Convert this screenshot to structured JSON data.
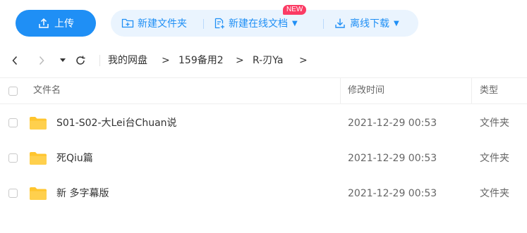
{
  "toolbar": {
    "upload_label": "上传",
    "new_folder_label": "新建文件夹",
    "new_online_doc_label": "新建在线文档",
    "new_badge": "NEW",
    "offline_download_label": "离线下载"
  },
  "navigation": {
    "back_icon": "chevron-left-icon",
    "forward_icon": "chevron-right-icon",
    "history_icon": "caret-down-icon",
    "refresh_icon": "refresh-icon",
    "breadcrumb": [
      "我的网盘",
      "159备用2",
      "R-刃Ya"
    ],
    "separator": ">"
  },
  "table": {
    "columns": [
      "文件名",
      "修改时间",
      "类型"
    ],
    "rows": [
      {
        "name": "S01-S02-大Lei台Chuan说",
        "modified": "2021-12-29 00:53",
        "type": "文件夹",
        "icon": "folder-icon"
      },
      {
        "name": "死Qiu篇",
        "modified": "2021-12-29 00:53",
        "type": "文件夹",
        "icon": "folder-icon"
      },
      {
        "name": "新 多字幕版",
        "modified": "2021-12-29 00:53",
        "type": "文件夹",
        "icon": "folder-icon"
      }
    ]
  },
  "colors": {
    "accent": "#1f8ff5",
    "toolbar_group_bg": "#eaf4fe",
    "badge": "#fb3b64",
    "folder": "#ffc52e"
  }
}
